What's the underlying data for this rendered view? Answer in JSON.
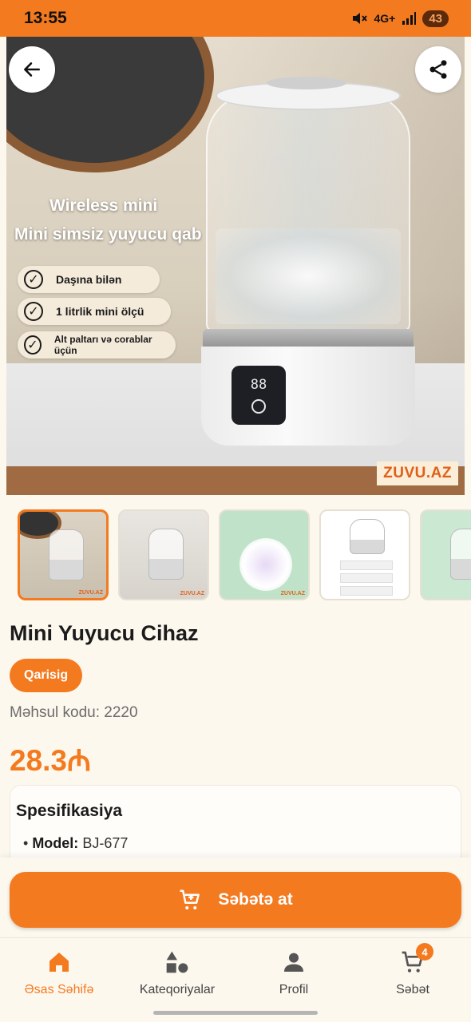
{
  "status_bar": {
    "time": "13:55",
    "network": "4G+",
    "battery": "43"
  },
  "hero": {
    "promo_line_1": "Wireless mini",
    "promo_line_2": "Mini simsiz yuyucu qab",
    "features": [
      "Daşına bilən",
      "1 litrlik mini ölçü",
      "Alt paltarı və corablar üçün"
    ],
    "brand": "ZUVU.AZ",
    "display_digits": "88"
  },
  "thumbnails": {
    "count": 5,
    "active_index": 0,
    "label": "ZUVU.AZ"
  },
  "product": {
    "title": "Mini Yuyucu Cihaz",
    "variant": "Qarisig",
    "code_label": "Məhsul kodu:",
    "code_value": "2220",
    "price": "28.3₼"
  },
  "spec": {
    "title": "Spesifikasiya",
    "items": [
      {
        "key": "Model:",
        "value": "BJ-677"
      }
    ]
  },
  "actions": {
    "add_to_cart": "Səbətə at"
  },
  "nav": {
    "items": [
      {
        "label": "Əsas Səhifə",
        "icon": "home-icon",
        "active": true
      },
      {
        "label": "Kateqoriyalar",
        "icon": "categories-icon",
        "active": false
      },
      {
        "label": "Profil",
        "icon": "profile-icon",
        "active": false
      },
      {
        "label": "Səbət",
        "icon": "cart-icon",
        "active": false
      }
    ],
    "cart_badge": "4"
  },
  "colors": {
    "accent": "#f47a20",
    "background": "#fdf8ee"
  }
}
